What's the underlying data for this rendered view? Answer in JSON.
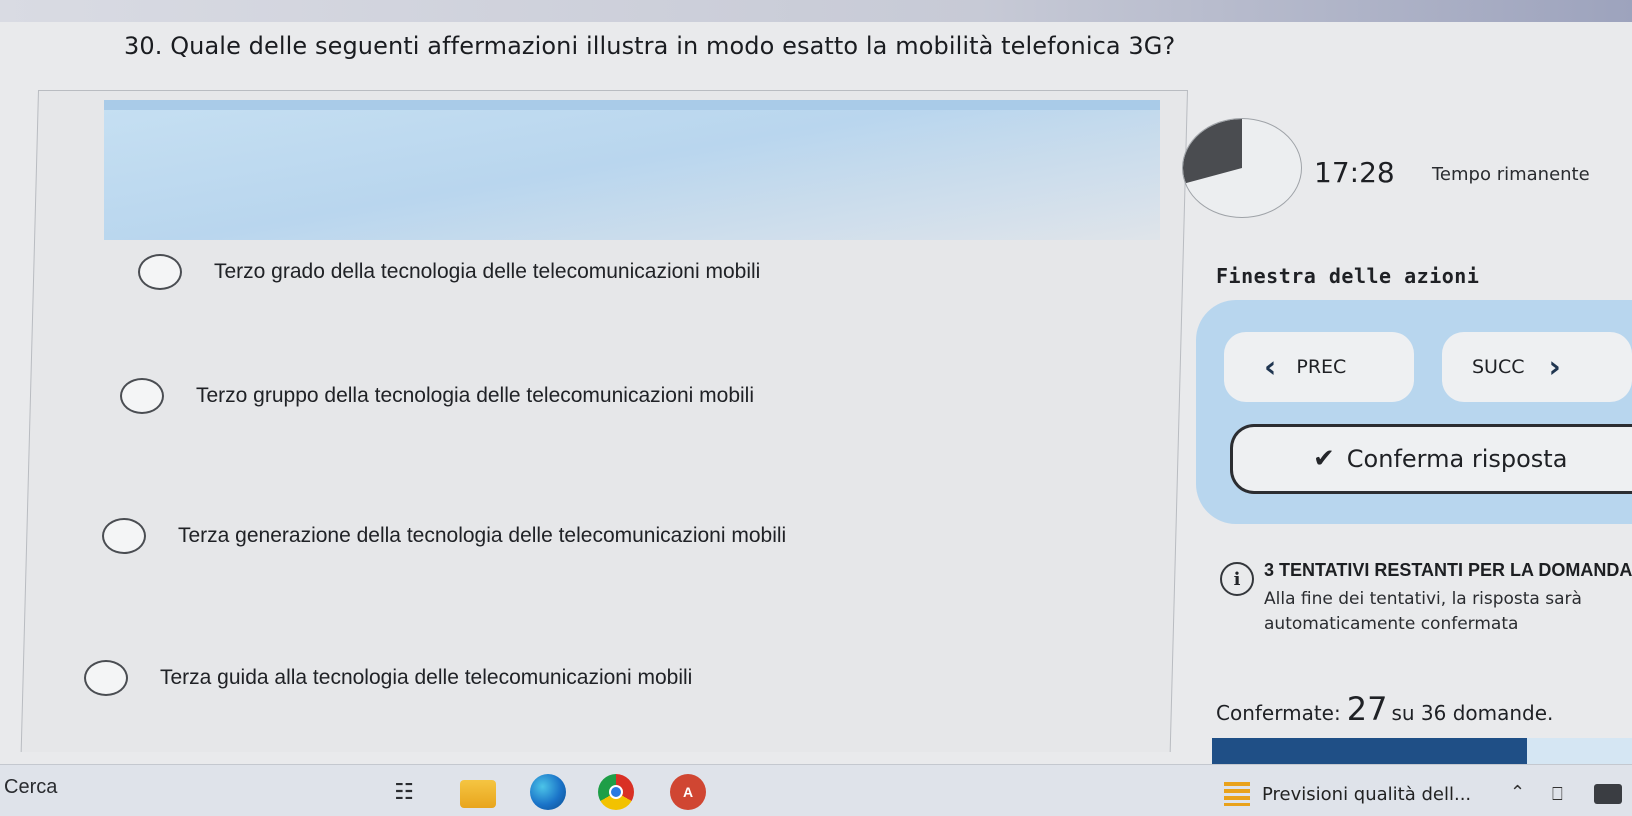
{
  "question": {
    "text": "30. Quale delle seguenti affermazioni illustra in modo esatto la mobilità telefonica 3G?"
  },
  "options": [
    {
      "label": "Terzo grado della tecnologia delle telecomunicazioni mobili"
    },
    {
      "label": "Terzo gruppo della tecnologia delle telecomunicazioni mobili"
    },
    {
      "label": "Terza generazione della tecnologia delle telecomunicazioni mobili"
    },
    {
      "label": "Terza guida alla tecnologia delle telecomunicazioni mobili"
    }
  ],
  "timer": {
    "value": "17:28",
    "label": "Tempo rimanente",
    "elapsed_fraction": 0.3
  },
  "actions": {
    "title": "Finestra delle azioni",
    "prev_label": "PREC",
    "next_label": "SUCC",
    "confirm_label": "Conferma risposta"
  },
  "info": {
    "title": "3 TENTATIVI RESTANTI PER LA DOMANDA",
    "text": "Alla fine dei tentativi, la risposta sarà automaticamente confermata"
  },
  "progress": {
    "prefix": "Confermate:",
    "count": "27",
    "suffix": "su 36 domande.",
    "fraction": 0.75
  },
  "taskbar": {
    "search_label": "Cerca",
    "weather_text": "Previsioni qualità dell...",
    "app_letter": "A"
  },
  "colors": {
    "accent": "#b8d6ee",
    "progress_fill": "#1f4f86",
    "timer_fill": "#4a4c50"
  }
}
